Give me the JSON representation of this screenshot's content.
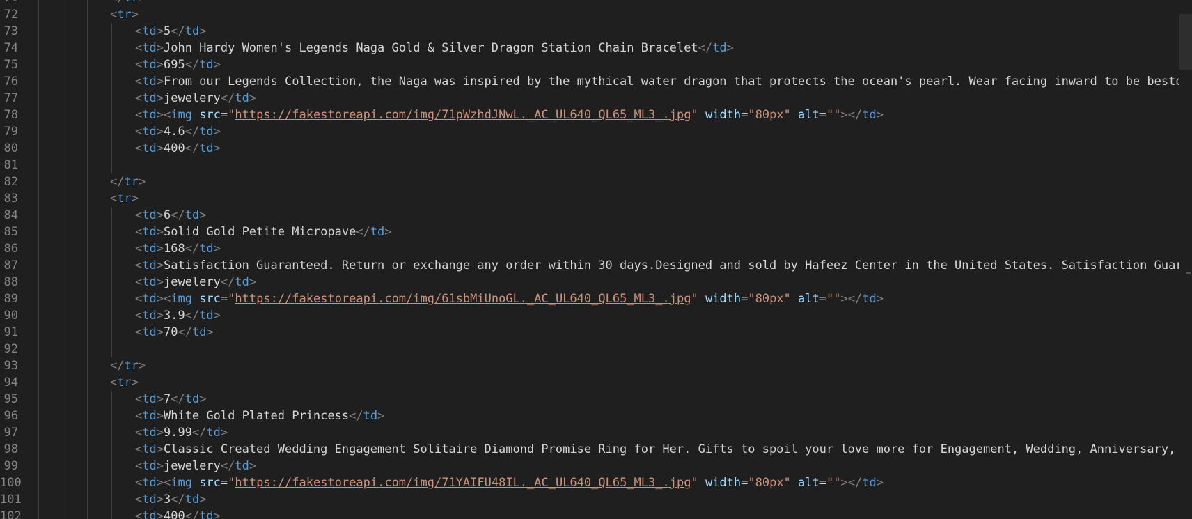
{
  "editor": {
    "language": "html",
    "lines": [
      {
        "n": "71",
        "indent": 2,
        "tokens": [
          [
            "t",
            "</"
          ],
          [
            "tag",
            "tr"
          ],
          [
            "t",
            ">"
          ]
        ]
      },
      {
        "n": "72",
        "indent": 2,
        "tokens": [
          [
            "t",
            "<"
          ],
          [
            "tag",
            "tr"
          ],
          [
            "t",
            ">"
          ]
        ]
      },
      {
        "n": "73",
        "indent": 3,
        "tokens": [
          [
            "t",
            "<"
          ],
          [
            "tag",
            "td"
          ],
          [
            "t",
            ">"
          ],
          [
            "txt",
            "5"
          ],
          [
            "t",
            "</"
          ],
          [
            "tag",
            "td"
          ],
          [
            "t",
            ">"
          ]
        ]
      },
      {
        "n": "74",
        "indent": 3,
        "tokens": [
          [
            "t",
            "<"
          ],
          [
            "tag",
            "td"
          ],
          [
            "t",
            ">"
          ],
          [
            "txt",
            "John Hardy Women's Legends Naga Gold & Silver Dragon Station Chain Bracelet"
          ],
          [
            "t",
            "</"
          ],
          [
            "tag",
            "td"
          ],
          [
            "t",
            ">"
          ]
        ]
      },
      {
        "n": "75",
        "indent": 3,
        "tokens": [
          [
            "t",
            "<"
          ],
          [
            "tag",
            "td"
          ],
          [
            "t",
            ">"
          ],
          [
            "txt",
            "695"
          ],
          [
            "t",
            "</"
          ],
          [
            "tag",
            "td"
          ],
          [
            "t",
            ">"
          ]
        ]
      },
      {
        "n": "76",
        "indent": 3,
        "tokens": [
          [
            "t",
            "<"
          ],
          [
            "tag",
            "td"
          ],
          [
            "t",
            ">"
          ],
          [
            "txt",
            "From our Legends Collection, the Naga was inspired by the mythical water dragon that protects the ocean's pearl. Wear facing inward to be bestowed with"
          ]
        ]
      },
      {
        "n": "77",
        "indent": 3,
        "tokens": [
          [
            "t",
            "<"
          ],
          [
            "tag",
            "td"
          ],
          [
            "t",
            ">"
          ],
          [
            "txt",
            "jewelery"
          ],
          [
            "t",
            "</"
          ],
          [
            "tag",
            "td"
          ],
          [
            "t",
            ">"
          ]
        ]
      },
      {
        "n": "78",
        "indent": 3,
        "tokens": [
          [
            "t",
            "<"
          ],
          [
            "tag",
            "td"
          ],
          [
            "t",
            "><"
          ],
          [
            "tag",
            "img"
          ],
          [
            "txt",
            " "
          ],
          [
            "an",
            "src"
          ],
          [
            "eq",
            "="
          ],
          [
            "sv",
            "\""
          ],
          [
            "url",
            "https://fakestoreapi.com/img/71pWzhdJNwL._AC_UL640_QL65_ML3_.jpg"
          ],
          [
            "sv",
            "\""
          ],
          [
            "txt",
            " "
          ],
          [
            "an",
            "width"
          ],
          [
            "eq",
            "="
          ],
          [
            "sv",
            "\"80px\""
          ],
          [
            "txt",
            " "
          ],
          [
            "an",
            "alt"
          ],
          [
            "eq",
            "="
          ],
          [
            "sv",
            "\"\""
          ],
          [
            "t",
            "></"
          ],
          [
            "tag",
            "td"
          ],
          [
            "t",
            ">"
          ]
        ]
      },
      {
        "n": "79",
        "indent": 3,
        "tokens": [
          [
            "t",
            "<"
          ],
          [
            "tag",
            "td"
          ],
          [
            "t",
            ">"
          ],
          [
            "txt",
            "4.6"
          ],
          [
            "t",
            "</"
          ],
          [
            "tag",
            "td"
          ],
          [
            "t",
            ">"
          ]
        ]
      },
      {
        "n": "80",
        "indent": 3,
        "tokens": [
          [
            "t",
            "<"
          ],
          [
            "tag",
            "td"
          ],
          [
            "t",
            ">"
          ],
          [
            "txt",
            "400"
          ],
          [
            "t",
            "</"
          ],
          [
            "tag",
            "td"
          ],
          [
            "t",
            ">"
          ]
        ]
      },
      {
        "n": "81",
        "indent": 3,
        "tokens": []
      },
      {
        "n": "82",
        "indent": 2,
        "tokens": [
          [
            "t",
            "</"
          ],
          [
            "tag",
            "tr"
          ],
          [
            "t",
            ">"
          ]
        ]
      },
      {
        "n": "83",
        "indent": 2,
        "tokens": [
          [
            "t",
            "<"
          ],
          [
            "tag",
            "tr"
          ],
          [
            "t",
            ">"
          ]
        ]
      },
      {
        "n": "84",
        "indent": 3,
        "tokens": [
          [
            "t",
            "<"
          ],
          [
            "tag",
            "td"
          ],
          [
            "t",
            ">"
          ],
          [
            "txt",
            "6"
          ],
          [
            "t",
            "</"
          ],
          [
            "tag",
            "td"
          ],
          [
            "t",
            ">"
          ]
        ]
      },
      {
        "n": "85",
        "indent": 3,
        "tokens": [
          [
            "t",
            "<"
          ],
          [
            "tag",
            "td"
          ],
          [
            "t",
            ">"
          ],
          [
            "txt",
            "Solid Gold Petite Micropave"
          ],
          [
            "t",
            "</"
          ],
          [
            "tag",
            "td"
          ],
          [
            "t",
            ">"
          ]
        ]
      },
      {
        "n": "86",
        "indent": 3,
        "tokens": [
          [
            "t",
            "<"
          ],
          [
            "tag",
            "td"
          ],
          [
            "t",
            ">"
          ],
          [
            "txt",
            "168"
          ],
          [
            "t",
            "</"
          ],
          [
            "tag",
            "td"
          ],
          [
            "t",
            ">"
          ]
        ]
      },
      {
        "n": "87",
        "indent": 3,
        "tokens": [
          [
            "t",
            "<"
          ],
          [
            "tag",
            "td"
          ],
          [
            "t",
            ">"
          ],
          [
            "txt",
            "Satisfaction Guaranteed. Return or exchange any order within 30 days.Designed and sold by Hafeez Center in the United States. Satisfaction Guaranteed."
          ]
        ]
      },
      {
        "n": "88",
        "indent": 3,
        "tokens": [
          [
            "t",
            "<"
          ],
          [
            "tag",
            "td"
          ],
          [
            "t",
            ">"
          ],
          [
            "txt",
            "jewelery"
          ],
          [
            "t",
            "</"
          ],
          [
            "tag",
            "td"
          ],
          [
            "t",
            ">"
          ]
        ]
      },
      {
        "n": "89",
        "indent": 3,
        "tokens": [
          [
            "t",
            "<"
          ],
          [
            "tag",
            "td"
          ],
          [
            "t",
            "><"
          ],
          [
            "tag",
            "img"
          ],
          [
            "txt",
            " "
          ],
          [
            "an",
            "src"
          ],
          [
            "eq",
            "="
          ],
          [
            "sv",
            "\""
          ],
          [
            "url",
            "https://fakestoreapi.com/img/61sbMiUnoGL._AC_UL640_QL65_ML3_.jpg"
          ],
          [
            "sv",
            "\""
          ],
          [
            "txt",
            " "
          ],
          [
            "an",
            "width"
          ],
          [
            "eq",
            "="
          ],
          [
            "sv",
            "\"80px\""
          ],
          [
            "txt",
            " "
          ],
          [
            "an",
            "alt"
          ],
          [
            "eq",
            "="
          ],
          [
            "sv",
            "\"\""
          ],
          [
            "t",
            "></"
          ],
          [
            "tag",
            "td"
          ],
          [
            "t",
            ">"
          ]
        ]
      },
      {
        "n": "90",
        "indent": 3,
        "tokens": [
          [
            "t",
            "<"
          ],
          [
            "tag",
            "td"
          ],
          [
            "t",
            ">"
          ],
          [
            "txt",
            "3.9"
          ],
          [
            "t",
            "</"
          ],
          [
            "tag",
            "td"
          ],
          [
            "t",
            ">"
          ]
        ]
      },
      {
        "n": "91",
        "indent": 3,
        "tokens": [
          [
            "t",
            "<"
          ],
          [
            "tag",
            "td"
          ],
          [
            "t",
            ">"
          ],
          [
            "txt",
            "70"
          ],
          [
            "t",
            "</"
          ],
          [
            "tag",
            "td"
          ],
          [
            "t",
            ">"
          ]
        ]
      },
      {
        "n": "92",
        "indent": 3,
        "tokens": []
      },
      {
        "n": "93",
        "indent": 2,
        "tokens": [
          [
            "t",
            "</"
          ],
          [
            "tag",
            "tr"
          ],
          [
            "t",
            ">"
          ]
        ]
      },
      {
        "n": "94",
        "indent": 2,
        "tokens": [
          [
            "t",
            "<"
          ],
          [
            "tag",
            "tr"
          ],
          [
            "t",
            ">"
          ]
        ]
      },
      {
        "n": "95",
        "indent": 3,
        "tokens": [
          [
            "t",
            "<"
          ],
          [
            "tag",
            "td"
          ],
          [
            "t",
            ">"
          ],
          [
            "txt",
            "7"
          ],
          [
            "t",
            "</"
          ],
          [
            "tag",
            "td"
          ],
          [
            "t",
            ">"
          ]
        ]
      },
      {
        "n": "96",
        "indent": 3,
        "tokens": [
          [
            "t",
            "<"
          ],
          [
            "tag",
            "td"
          ],
          [
            "t",
            ">"
          ],
          [
            "txt",
            "White Gold Plated Princess"
          ],
          [
            "t",
            "</"
          ],
          [
            "tag",
            "td"
          ],
          [
            "t",
            ">"
          ]
        ]
      },
      {
        "n": "97",
        "indent": 3,
        "tokens": [
          [
            "t",
            "<"
          ],
          [
            "tag",
            "td"
          ],
          [
            "t",
            ">"
          ],
          [
            "txt",
            "9.99"
          ],
          [
            "t",
            "</"
          ],
          [
            "tag",
            "td"
          ],
          [
            "t",
            ">"
          ]
        ]
      },
      {
        "n": "98",
        "indent": 3,
        "tokens": [
          [
            "t",
            "<"
          ],
          [
            "tag",
            "td"
          ],
          [
            "t",
            ">"
          ],
          [
            "txt",
            "Classic Created Wedding Engagement Solitaire Diamond Promise Ring for Her. Gifts to spoil your love more for Engagement, Wedding, Anniversary, Valentin"
          ]
        ]
      },
      {
        "n": "99",
        "indent": 3,
        "tokens": [
          [
            "t",
            "<"
          ],
          [
            "tag",
            "td"
          ],
          [
            "t",
            ">"
          ],
          [
            "txt",
            "jewelery"
          ],
          [
            "t",
            "</"
          ],
          [
            "tag",
            "td"
          ],
          [
            "t",
            ">"
          ]
        ]
      },
      {
        "n": "100",
        "indent": 3,
        "tokens": [
          [
            "t",
            "<"
          ],
          [
            "tag",
            "td"
          ],
          [
            "t",
            "><"
          ],
          [
            "tag",
            "img"
          ],
          [
            "txt",
            " "
          ],
          [
            "an",
            "src"
          ],
          [
            "eq",
            "="
          ],
          [
            "sv",
            "\""
          ],
          [
            "url",
            "https://fakestoreapi.com/img/71YAIFU48IL._AC_UL640_QL65_ML3_.jpg"
          ],
          [
            "sv",
            "\""
          ],
          [
            "txt",
            " "
          ],
          [
            "an",
            "width"
          ],
          [
            "eq",
            "="
          ],
          [
            "sv",
            "\"80px\""
          ],
          [
            "txt",
            " "
          ],
          [
            "an",
            "alt"
          ],
          [
            "eq",
            "="
          ],
          [
            "sv",
            "\"\""
          ],
          [
            "t",
            "></"
          ],
          [
            "tag",
            "td"
          ],
          [
            "t",
            ">"
          ]
        ]
      },
      {
        "n": "101",
        "indent": 3,
        "tokens": [
          [
            "t",
            "<"
          ],
          [
            "tag",
            "td"
          ],
          [
            "t",
            ">"
          ],
          [
            "txt",
            "3"
          ],
          [
            "t",
            "</"
          ],
          [
            "tag",
            "td"
          ],
          [
            "t",
            ">"
          ]
        ]
      },
      {
        "n": "102",
        "indent": 3,
        "tokens": [
          [
            "t",
            "<"
          ],
          [
            "tag",
            "td"
          ],
          [
            "t",
            ">"
          ],
          [
            "txt",
            "400"
          ],
          [
            "t",
            "</"
          ],
          [
            "tag",
            "td"
          ],
          [
            "t",
            ">"
          ]
        ]
      }
    ]
  },
  "colors": {
    "background": "#1f1f1f",
    "line_number": "#858585",
    "tag_bracket": "#808080",
    "tag_name": "#569cd6",
    "text": "#d4d4d4",
    "attr_name": "#9cdcfe",
    "string": "#ce9178"
  }
}
